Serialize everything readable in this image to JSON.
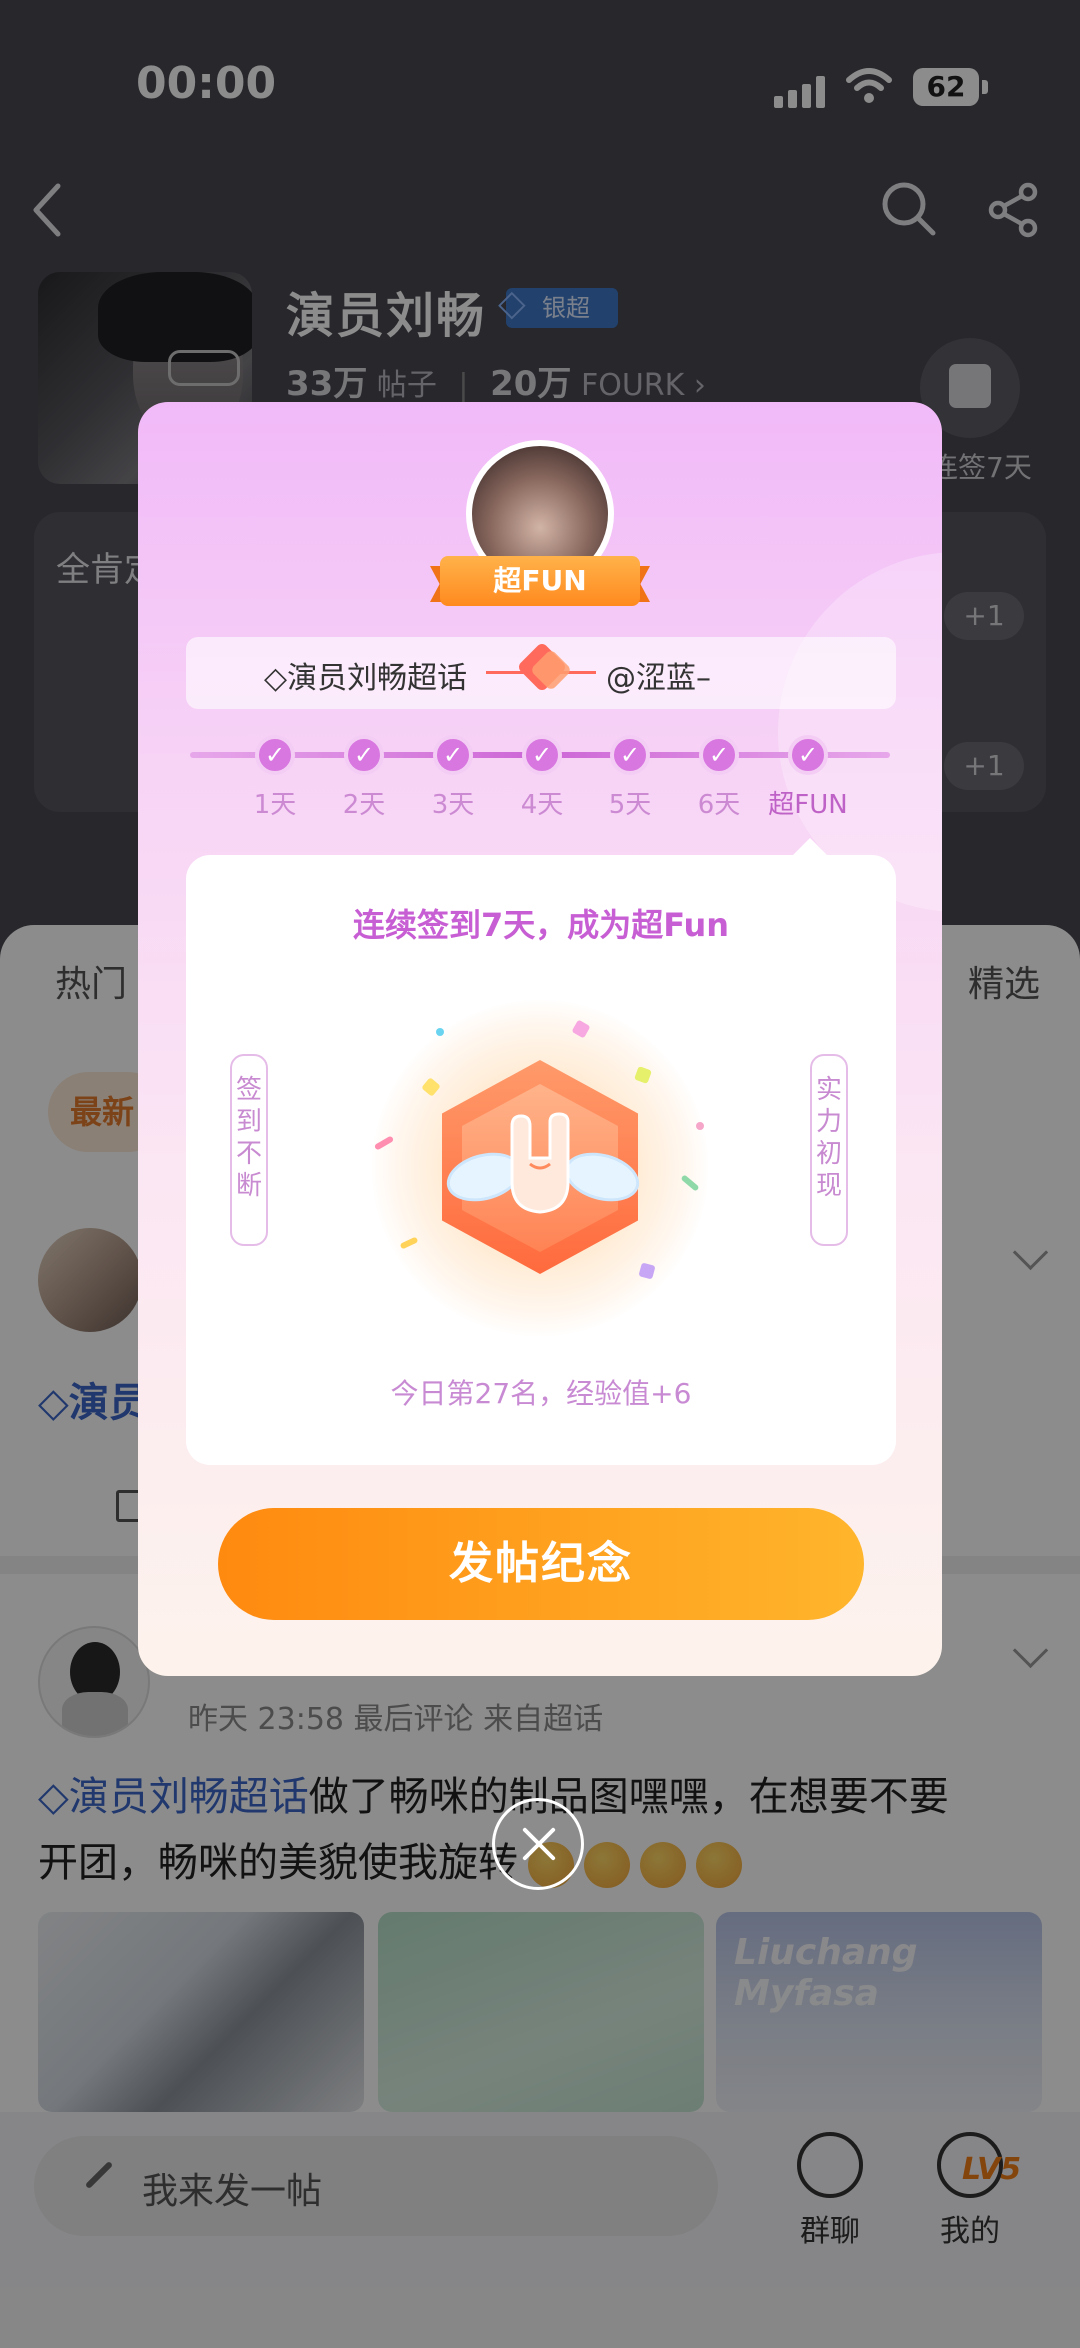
{
  "status_bar": {
    "time": "00:00",
    "battery": "62"
  },
  "header": {
    "title": "演员刘畅",
    "rank_badge": "银超",
    "posts_count": "33万",
    "posts_label": "帖子",
    "fans_count": "20万",
    "fans_label": "FOURK",
    "checkin_text": "连签7天"
  },
  "feature_card": {
    "title": "全肯定",
    "plus_1": "+1",
    "plus_2": "+1"
  },
  "tabs": {
    "left": "热门",
    "right": "精选"
  },
  "filter_pill": "最新",
  "post1": {
    "topic_prefix": "演员"
  },
  "post2": {
    "meta": "昨天 23:58  最后评论  来自超话",
    "topic": "演员刘畅超话",
    "text_line1_rest": "做了畅咪的制品图嘿嘿，在想要不要",
    "text_line2": "开团，畅咪的美貌使我旋转",
    "thumb3_watermark": "Liuchang Myfasa"
  },
  "bottom_bar": {
    "compose_placeholder": "我来发一帖",
    "group_chat": "群聊",
    "mine": "我的",
    "level": "LV5"
  },
  "popup": {
    "ribbon": "超FUN",
    "supertopic": "演员刘畅超话",
    "username": "@涩蓝–",
    "days": [
      "1天",
      "2天",
      "3天",
      "4天",
      "5天",
      "6天",
      "超FUN"
    ],
    "check_mark": "✓",
    "card_title": "连续签到7天，成为超Fun",
    "left_vertical": "签到不断",
    "right_vertical": "实力初现",
    "result": "今日第27名，经验值+6",
    "cta": "发帖纪念"
  },
  "colors": {
    "accent_orange": "#ff9a1a",
    "popup_pink": "#f1b9f8",
    "topic_blue": "#3b67c6",
    "title_purple": "#c75ed3"
  }
}
